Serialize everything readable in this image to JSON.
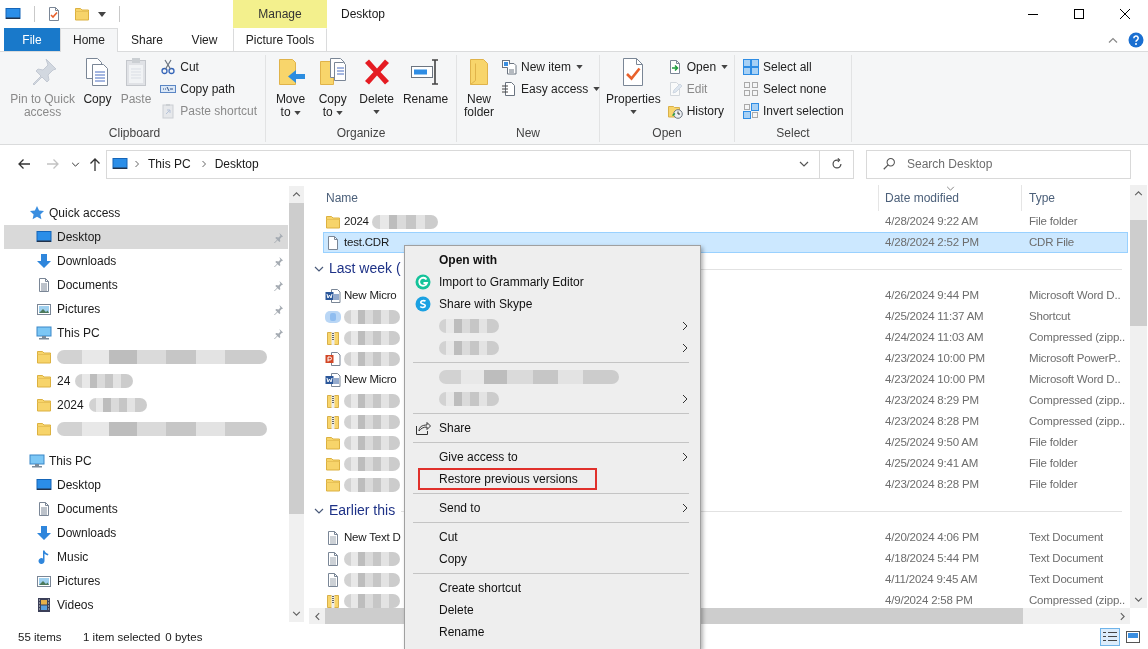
{
  "title_bar": {
    "title": "Desktop",
    "tool_group": "Manage"
  },
  "ribbon_tabs": [
    {
      "label": "File",
      "kind": "file",
      "selected": false
    },
    {
      "label": "Home",
      "kind": "tab",
      "selected": true
    },
    {
      "label": "Share",
      "kind": "tab",
      "selected": false
    },
    {
      "label": "View",
      "kind": "tab",
      "selected": false
    },
    {
      "label": "Picture Tools",
      "kind": "contextual",
      "selected": false
    }
  ],
  "ribbon_groups": [
    {
      "label": "Clipboard",
      "buttons": [
        {
          "kind": "large",
          "label": "Pin to Quick access",
          "dropdown": false,
          "disabled": true
        },
        {
          "kind": "large",
          "label": "Copy",
          "dropdown": false,
          "disabled": false
        },
        {
          "kind": "large",
          "label": "Paste",
          "dropdown": false,
          "disabled": true
        },
        {
          "kind": "small",
          "label": "Cut",
          "dropdown": false,
          "disabled": false
        },
        {
          "kind": "small",
          "label": "Copy path",
          "dropdown": false,
          "disabled": false
        },
        {
          "kind": "small",
          "label": "Paste shortcut",
          "dropdown": false,
          "disabled": true
        }
      ]
    },
    {
      "label": "Organize",
      "buttons": [
        {
          "kind": "large",
          "label": "Move to",
          "dropdown": true,
          "disabled": false
        },
        {
          "kind": "large",
          "label": "Copy to",
          "dropdown": true,
          "disabled": false
        },
        {
          "kind": "large",
          "label": "Delete",
          "dropdown": true,
          "disabled": false
        },
        {
          "kind": "large",
          "label": "Rename",
          "dropdown": false,
          "disabled": false
        }
      ]
    },
    {
      "label": "New",
      "buttons": [
        {
          "kind": "large",
          "label": "New folder",
          "dropdown": false,
          "disabled": false
        },
        {
          "kind": "small",
          "label": "New item",
          "dropdown": true,
          "disabled": false
        },
        {
          "kind": "small",
          "label": "Easy access",
          "dropdown": true,
          "disabled": false
        }
      ]
    },
    {
      "label": "Open",
      "buttons": [
        {
          "kind": "large",
          "label": "Properties",
          "dropdown": true,
          "disabled": false
        },
        {
          "kind": "small",
          "label": "Open",
          "dropdown": true,
          "disabled": false
        },
        {
          "kind": "small",
          "label": "Edit",
          "dropdown": false,
          "disabled": true
        },
        {
          "kind": "small",
          "label": "History",
          "dropdown": false,
          "disabled": false
        }
      ]
    },
    {
      "label": "Select",
      "buttons": [
        {
          "kind": "small",
          "label": "Select all",
          "dropdown": false,
          "disabled": false
        },
        {
          "kind": "small",
          "label": "Select none",
          "dropdown": false,
          "disabled": false
        },
        {
          "kind": "small",
          "label": "Invert selection",
          "dropdown": false,
          "disabled": false
        }
      ]
    }
  ],
  "nav_buttons": [
    {
      "kind": "back",
      "disabled": false
    },
    {
      "kind": "forward",
      "disabled": true
    },
    {
      "kind": "recent",
      "disabled": false
    },
    {
      "kind": "up",
      "disabled": false
    }
  ],
  "address_bar": {
    "crumbs": [
      "This PC",
      "Desktop"
    ]
  },
  "search": {
    "placeholder": "Search Desktop"
  },
  "sidebar": {
    "items": [
      {
        "label": "Quick access",
        "kind": "quick_access",
        "selected": false,
        "pinned": false,
        "redacted": false,
        "children": [
          {
            "label": "Desktop",
            "kind": "desktop",
            "selected": true,
            "pinned": true,
            "redacted": false
          },
          {
            "label": "Downloads",
            "kind": "downloads",
            "selected": false,
            "pinned": true,
            "redacted": false
          },
          {
            "label": "Documents",
            "kind": "documents",
            "selected": false,
            "pinned": true,
            "redacted": false
          },
          {
            "label": "Pictures",
            "kind": "pictures",
            "selected": false,
            "pinned": true,
            "redacted": false
          },
          {
            "label": "This PC",
            "kind": "pc",
            "selected": false,
            "pinned": true,
            "redacted": false
          },
          {
            "kind": "folder",
            "selected": false,
            "pinned": false,
            "redacted": true
          },
          {
            "label": "24",
            "kind": "folder",
            "selected": false,
            "pinned": false,
            "redacted": true
          },
          {
            "label": "2024",
            "kind": "folder",
            "selected": false,
            "pinned": false,
            "redacted": true
          },
          {
            "kind": "folder",
            "selected": false,
            "pinned": false,
            "redacted": true
          }
        ]
      },
      {
        "label": "This PC",
        "kind": "pc",
        "selected": false,
        "pinned": false,
        "redacted": false,
        "children": [
          {
            "label": "Desktop",
            "kind": "desktop",
            "selected": false,
            "pinned": false,
            "redacted": false
          },
          {
            "label": "Documents",
            "kind": "documents",
            "selected": false,
            "pinned": false,
            "redacted": false
          },
          {
            "label": "Downloads",
            "kind": "downloads",
            "selected": false,
            "pinned": false,
            "redacted": false
          },
          {
            "label": "Music",
            "kind": "music",
            "selected": false,
            "pinned": false,
            "redacted": false
          },
          {
            "label": "Pictures",
            "kind": "pictures",
            "selected": false,
            "pinned": false,
            "redacted": false
          },
          {
            "label": "Videos",
            "kind": "videos",
            "selected": false,
            "pinned": false,
            "redacted": false
          }
        ]
      }
    ]
  },
  "file_list": {
    "columns": [
      {
        "label": "Name",
        "sorted": false
      },
      {
        "label": "Date modified",
        "sorted": true
      },
      {
        "label": "Type",
        "sorted": false
      }
    ],
    "groups": [
      {
        "rows": [
          {
            "kind": "folder",
            "name": "2024",
            "redacted": true,
            "date": "4/28/2024 9:22 AM",
            "type": "File folder",
            "selected": false
          },
          {
            "kind": "file",
            "name": "test.CDR",
            "redacted": false,
            "date": "4/28/2024 2:52 PM",
            "type": "CDR File",
            "selected": true
          }
        ]
      },
      {
        "label": "Last week (",
        "rows": [
          {
            "kind": "word",
            "name": "New Micro",
            "redacted": false,
            "date": "4/26/2024 9:44 PM",
            "type": "Microsoft Word D..",
            "selected": false
          },
          {
            "kind": "shortcut",
            "redacted": true,
            "date": "4/25/2024 11:37 AM",
            "type": "Shortcut",
            "selected": false
          },
          {
            "kind": "zip",
            "redacted": true,
            "date": "4/24/2024 11:03 AM",
            "type": "Compressed (zipp..",
            "selected": false
          },
          {
            "kind": "powerpoint",
            "redacted": true,
            "date": "4/23/2024 10:00 PM",
            "type": "Microsoft PowerP..",
            "selected": false
          },
          {
            "kind": "word",
            "name": "New Micro",
            "redacted": false,
            "date": "4/23/2024 10:00 PM",
            "type": "Microsoft Word D..",
            "selected": false
          },
          {
            "kind": "zip",
            "redacted": true,
            "date": "4/23/2024 8:29 PM",
            "type": "Compressed (zipp..",
            "selected": false
          },
          {
            "kind": "zip",
            "redacted": true,
            "date": "4/23/2024 8:28 PM",
            "type": "Compressed (zipp..",
            "selected": false
          },
          {
            "kind": "folder",
            "redacted": true,
            "date": "4/25/2024 9:50 AM",
            "type": "File folder",
            "selected": false
          },
          {
            "kind": "folder",
            "redacted": true,
            "date": "4/25/2024 9:41 AM",
            "type": "File folder",
            "selected": false
          },
          {
            "kind": "folder",
            "redacted": true,
            "date": "4/23/2024 8:28 PM",
            "type": "File folder",
            "selected": false
          }
        ]
      },
      {
        "label": "Earlier this",
        "rows": [
          {
            "kind": "text",
            "name": "New Text D",
            "redacted": false,
            "date": "4/20/2024 4:06 PM",
            "type": "Text Document",
            "selected": false
          },
          {
            "kind": "text",
            "redacted": true,
            "date": "4/18/2024 5:44 PM",
            "type": "Text Document",
            "selected": false
          },
          {
            "kind": "text",
            "redacted": true,
            "date": "4/11/2024 9:45 AM",
            "type": "Text Document",
            "selected": false
          },
          {
            "kind": "zip",
            "redacted": true,
            "date": "4/9/2024 2:58 PM",
            "type": "Compressed (zipp..",
            "selected": false
          }
        ]
      }
    ]
  },
  "status_bar": {
    "item_count": "55 items",
    "selection": "1 item selected",
    "size": "0 bytes",
    "views": [
      {
        "kind": "details",
        "selected": true
      },
      {
        "kind": "large_icons",
        "selected": false
      }
    ]
  },
  "context_menu": {
    "items": [
      {
        "kind": "item",
        "label": "Open with",
        "default": true,
        "submenu": false,
        "highlighted": false,
        "redacted": false
      },
      {
        "kind": "grammarly",
        "label": "Import to Grammarly Editor",
        "default": false,
        "submenu": false,
        "highlighted": false,
        "redacted": false
      },
      {
        "kind": "skype",
        "label": "Share with Skype",
        "default": false,
        "submenu": false,
        "highlighted": false,
        "redacted": false
      },
      {
        "kind": "item",
        "default": false,
        "submenu": true,
        "highlighted": false,
        "redacted": true
      },
      {
        "kind": "item",
        "default": false,
        "submenu": true,
        "highlighted": false,
        "redacted": true
      },
      {
        "kind": "separator"
      },
      {
        "kind": "item",
        "default": false,
        "submenu": false,
        "highlighted": false,
        "redacted": true
      },
      {
        "kind": "item",
        "default": false,
        "submenu": true,
        "highlighted": false,
        "redacted": true
      },
      {
        "kind": "separator"
      },
      {
        "kind": "share",
        "label": "Share",
        "default": false,
        "submenu": false,
        "highlighted": false,
        "redacted": false
      },
      {
        "kind": "separator"
      },
      {
        "kind": "item",
        "label": "Give access to",
        "default": false,
        "submenu": true,
        "highlighted": false,
        "redacted": false
      },
      {
        "kind": "item",
        "label": "Restore previous versions",
        "default": false,
        "submenu": false,
        "highlighted": true,
        "redacted": false
      },
      {
        "kind": "separator"
      },
      {
        "kind": "item",
        "label": "Send to",
        "default": false,
        "submenu": true,
        "highlighted": false,
        "redacted": false
      },
      {
        "kind": "separator"
      },
      {
        "kind": "item",
        "label": "Cut",
        "default": false,
        "submenu": false,
        "highlighted": false,
        "redacted": false
      },
      {
        "kind": "item",
        "label": "Copy",
        "default": false,
        "submenu": false,
        "highlighted": false,
        "redacted": false
      },
      {
        "kind": "separator"
      },
      {
        "kind": "item",
        "label": "Create shortcut",
        "default": false,
        "submenu": false,
        "highlighted": false,
        "redacted": false
      },
      {
        "kind": "item",
        "label": "Delete",
        "default": false,
        "submenu": false,
        "highlighted": false,
        "redacted": false
      },
      {
        "kind": "item",
        "label": "Rename",
        "default": false,
        "submenu": false,
        "highlighted": false,
        "redacted": false
      }
    ]
  }
}
